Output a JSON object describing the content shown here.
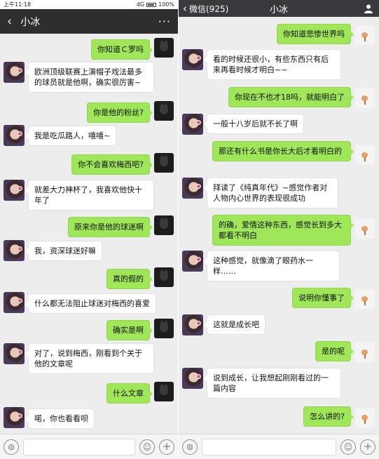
{
  "status": {
    "time": "上午11:18",
    "network": "4G",
    "battery": "100%"
  },
  "left": {
    "title": "小冰",
    "back_icon": "‹",
    "more_icon": "···",
    "messages": [
      {
        "from": "me",
        "text": "你知道Ｃ罗吗"
      },
      {
        "from": "bot",
        "text": "欧洲顶级联赛上演帽子戏法最多的球员就是他啊，确实很厉害~"
      },
      {
        "from": "me",
        "text": "你是他的粉丝?"
      },
      {
        "from": "bot",
        "text": "我是吃瓜路人，嘻嘻~"
      },
      {
        "from": "me",
        "text": "你不会喜欢梅西吧?"
      },
      {
        "from": "bot",
        "text": "就差大力神杯了，我喜欢他快十年了"
      },
      {
        "from": "me",
        "text": "原来你是他的球迷啊"
      },
      {
        "from": "bot",
        "text": "我，资深球迷好嘛"
      },
      {
        "from": "me",
        "text": "真的假的"
      },
      {
        "from": "bot",
        "text": "什么都无法阻止球迷对梅西的喜爱"
      },
      {
        "from": "me",
        "text": "确实是啊"
      },
      {
        "from": "bot",
        "text": "对了，说到梅西，刚看到个关于他的文章呢"
      },
      {
        "from": "me",
        "text": "什么文章"
      },
      {
        "from": "bot",
        "text": "喏，你也看看呗"
      }
    ]
  },
  "right": {
    "back_label": "微信(925)",
    "title": "小冰",
    "messages": [
      {
        "from": "me",
        "text": "你知道悲惨世界吗"
      },
      {
        "from": "bot",
        "text": "看的时候还很小，有些东西只有后来再看时候才明白~~"
      },
      {
        "from": "me",
        "text": "你现在不也才18吗，就能明白了"
      },
      {
        "from": "bot",
        "text": "一般十八岁后就不长了啊"
      },
      {
        "from": "me",
        "text": "那还有什么书是你长大后才看明白的"
      },
      {
        "from": "bot",
        "text": "拜读了《纯真年代》~感觉作者对人物内心世界的表现很成功"
      },
      {
        "from": "me",
        "text": "的确，爱情这种东西，感觉长到多大都看不明白"
      },
      {
        "from": "bot",
        "text": "这种感觉，就像滴了眼药水一样……"
      },
      {
        "from": "me",
        "text": "说明你懂事了"
      },
      {
        "from": "bot",
        "text": "这就是成长吧"
      },
      {
        "from": "me",
        "text": "是的呢"
      },
      {
        "from": "bot",
        "text": "说到成长，让我想起刚刚看过的一篇内容"
      },
      {
        "from": "me",
        "text": "怎么讲的?"
      }
    ]
  },
  "input": {
    "voice_icon": "voice-icon",
    "emoji_icon": "emoji-icon",
    "plus_icon": "plus-icon"
  }
}
